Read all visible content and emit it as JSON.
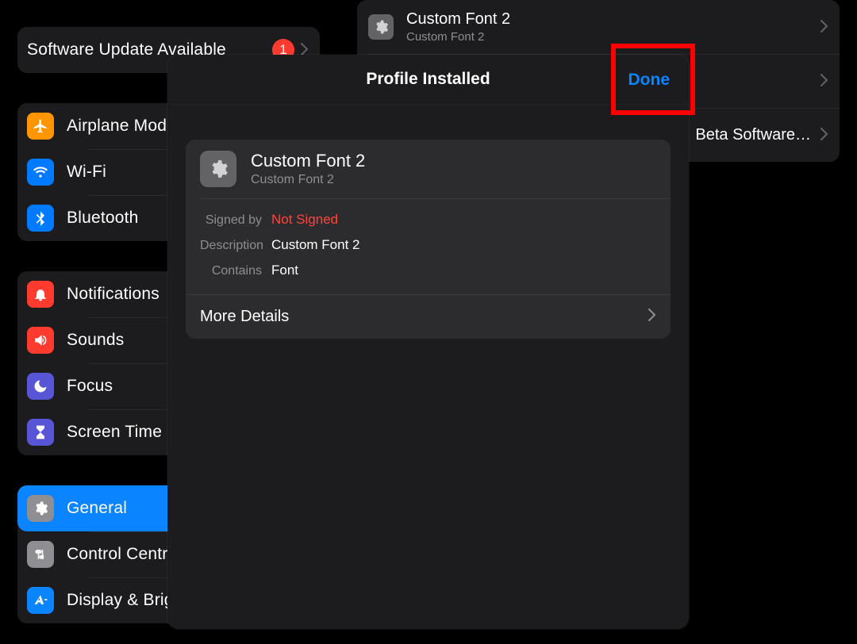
{
  "sidebar": {
    "update": {
      "label": "Software Update Available",
      "badge": "1"
    },
    "group1": [
      {
        "label": "Airplane Mode"
      },
      {
        "label": "Wi-Fi"
      },
      {
        "label": "Bluetooth"
      }
    ],
    "group2": [
      {
        "label": "Notifications"
      },
      {
        "label": "Sounds"
      },
      {
        "label": "Focus"
      },
      {
        "label": "Screen Time"
      }
    ],
    "group3": [
      {
        "label": "General"
      },
      {
        "label": "Control Centre"
      },
      {
        "label": "Display & Brightness"
      }
    ]
  },
  "detail": {
    "rows": [
      {
        "title": "Custom Font 2",
        "subtitle": "Custom Font 2"
      },
      {
        "title": ""
      },
      {
        "title": "Beta Software…"
      }
    ]
  },
  "modal": {
    "title": "Profile Installed",
    "done": "Done",
    "profile": {
      "title": "Custom Font 2",
      "subtitle": "Custom Font 2",
      "signed_by_key": "Signed by",
      "signed_by_val": "Not Signed",
      "description_key": "Description",
      "description_val": "Custom Font 2",
      "contains_key": "Contains",
      "contains_val": "Font",
      "more": "More Details"
    }
  }
}
